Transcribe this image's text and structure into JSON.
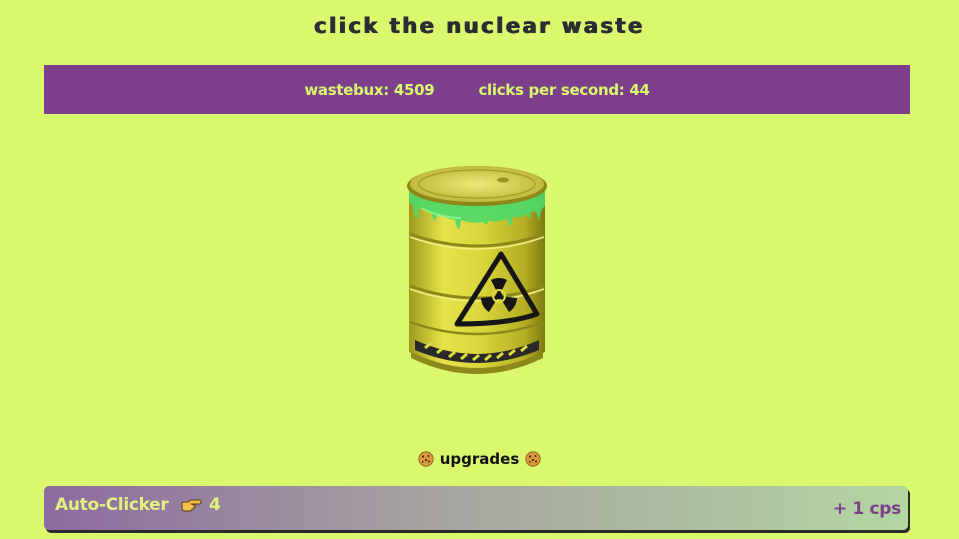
{
  "header": {
    "title": "click the nuclear waste"
  },
  "stats": {
    "wastebux": "wastebux: 4509",
    "cps": "clicks per second: 44"
  },
  "clicker": {
    "image": "radioactive-barrel-icon"
  },
  "upgrades": {
    "heading": "upgrades",
    "heading_icon": "cookie-icon",
    "items": [
      {
        "name": "Auto-Clicker",
        "icon": "pointing-hand-icon",
        "owned": "4",
        "cps": "+ 1 cps"
      }
    ]
  },
  "colors": {
    "background": "#d9f86e",
    "bar": "#7d3f8c",
    "bar_text": "#d9f86e"
  }
}
